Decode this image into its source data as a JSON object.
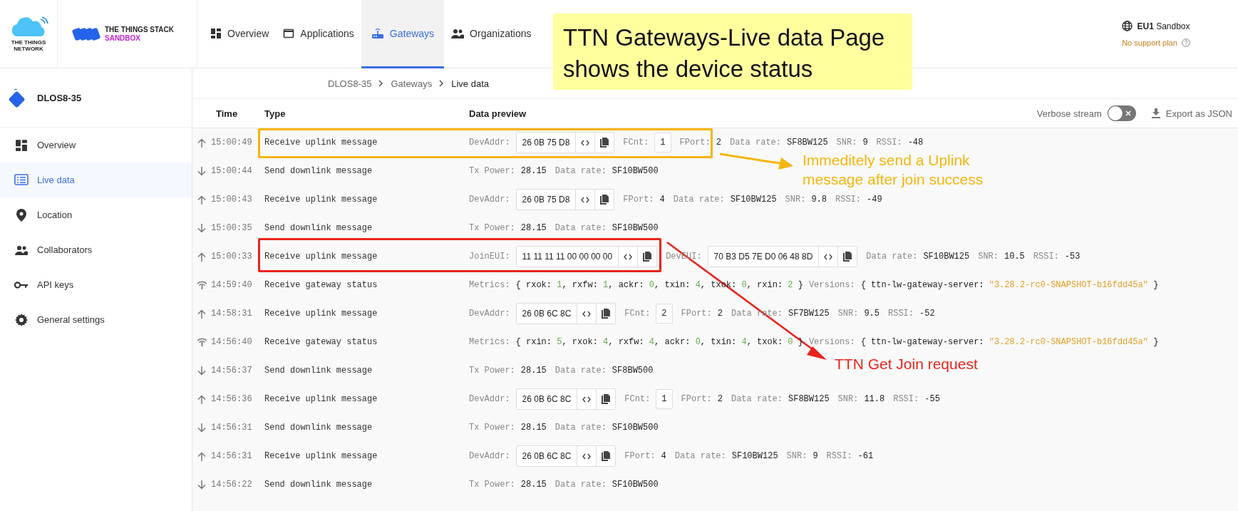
{
  "header": {
    "network_logo": [
      "THE THINGS",
      "NETWORK"
    ],
    "stack_logo": {
      "title": "THE THINGS STACK",
      "subtitle": "SANDBOX"
    },
    "nav": [
      {
        "label": "Overview",
        "selected": false
      },
      {
        "label": "Applications",
        "selected": false
      },
      {
        "label": "Gateways",
        "selected": true
      },
      {
        "label": "Organizations",
        "selected": false
      }
    ],
    "cluster": "**EU1** Sandbox",
    "support": "No support plan"
  },
  "sidebar": {
    "gateway": "DLOS8-35",
    "items": [
      {
        "label": "Overview",
        "selected": false
      },
      {
        "label": "Live data",
        "selected": true
      },
      {
        "label": "Location",
        "selected": false
      },
      {
        "label": "Collaborators",
        "selected": false
      },
      {
        "label": "API keys",
        "selected": false
      },
      {
        "label": "General settings",
        "selected": false
      }
    ]
  },
  "breadcrumb": [
    "DLOS8-35",
    "Gateways",
    "Live data"
  ],
  "table": {
    "columns": [
      "Time",
      "Type",
      "Data preview"
    ],
    "verbose_stream": {
      "label": "Verbose stream",
      "on": false
    },
    "export": "Export as JSON",
    "rows": [
      {
        "kind": "up",
        "time": "15:00:49",
        "type": "Receive uplink message",
        "preview": [
          {
            "kind": "key",
            "text": "DevAddr:"
          },
          {
            "kind": "hex",
            "text": "26 0B 75 D8"
          },
          {
            "kind": "key",
            "text": "FCnt:"
          },
          {
            "kind": "box",
            "text": "1"
          },
          {
            "kind": "key",
            "text": "FPort:"
          },
          {
            "kind": "val",
            "text": "2"
          },
          {
            "kind": "key",
            "text": "Data rate:"
          },
          {
            "kind": "val",
            "text": "SF8BW125"
          },
          {
            "kind": "key",
            "text": "SNR:"
          },
          {
            "kind": "val",
            "text": "9"
          },
          {
            "kind": "key",
            "text": "RSSI:"
          },
          {
            "kind": "val",
            "text": "-48"
          }
        ]
      },
      {
        "kind": "down",
        "time": "15:00:44",
        "type": "Send downlink message",
        "preview": [
          {
            "kind": "key",
            "text": "Tx Power:"
          },
          {
            "kind": "val",
            "text": "28.15"
          },
          {
            "kind": "key",
            "text": "Data rate:"
          },
          {
            "kind": "val",
            "text": "SF10BW500"
          }
        ]
      },
      {
        "kind": "up",
        "time": "15:00:43",
        "type": "Receive uplink message",
        "preview": [
          {
            "kind": "key",
            "text": "DevAddr:"
          },
          {
            "kind": "hex",
            "text": "26 0B 75 D8"
          },
          {
            "kind": "key",
            "text": "FPort:"
          },
          {
            "kind": "val",
            "text": "4"
          },
          {
            "kind": "key",
            "text": "Data rate:"
          },
          {
            "kind": "val",
            "text": "SF10BW125"
          },
          {
            "kind": "key",
            "text": "SNR:"
          },
          {
            "kind": "val",
            "text": "9.8"
          },
          {
            "kind": "key",
            "text": "RSSI:"
          },
          {
            "kind": "val",
            "text": "-49"
          }
        ]
      },
      {
        "kind": "down",
        "time": "15:00:35",
        "type": "Send downlink message",
        "preview": [
          {
            "kind": "key",
            "text": "Tx Power:"
          },
          {
            "kind": "val",
            "text": "28.15"
          },
          {
            "kind": "key",
            "text": "Data rate:"
          },
          {
            "kind": "val",
            "text": "SF10BW500"
          }
        ]
      },
      {
        "kind": "up",
        "time": "15:00:33",
        "type": "Receive uplink message",
        "preview": [
          {
            "kind": "key",
            "text": "JoinEUI:"
          },
          {
            "kind": "hex",
            "text": "11 11 11 11 00 00 00 00"
          },
          {
            "kind": "key",
            "text": "DevEUI:"
          },
          {
            "kind": "hex",
            "text": "70 B3 D5 7E D0 06 48 8D"
          },
          {
            "kind": "key",
            "text": "Data rate:"
          },
          {
            "kind": "val",
            "text": "SF10BW125"
          },
          {
            "kind": "key",
            "text": "SNR:"
          },
          {
            "kind": "val",
            "text": "10.5"
          },
          {
            "kind": "key",
            "text": "RSSI:"
          },
          {
            "kind": "val",
            "text": "-53"
          }
        ]
      },
      {
        "kind": "status",
        "time": "14:59:40",
        "type": "Receive gateway status",
        "preview": [
          {
            "kind": "key",
            "text": "Metrics:"
          },
          {
            "kind": "code",
            "text": "{ rxok: "
          },
          {
            "kind": "num",
            "text": "1"
          },
          {
            "kind": "code",
            "text": ", rxfw: "
          },
          {
            "kind": "num",
            "text": "1"
          },
          {
            "kind": "code",
            "text": ", ackr: "
          },
          {
            "kind": "num",
            "text": "0"
          },
          {
            "kind": "code",
            "text": ", txin: "
          },
          {
            "kind": "num",
            "text": "4"
          },
          {
            "kind": "code",
            "text": ", txok: "
          },
          {
            "kind": "num",
            "text": "0"
          },
          {
            "kind": "code",
            "text": ", rxin: "
          },
          {
            "kind": "num",
            "text": "2"
          },
          {
            "kind": "code",
            "text": " }"
          },
          {
            "kind": "key",
            "text": "Versions:"
          },
          {
            "kind": "code",
            "text": "{ ttn-lw-gateway-server: "
          },
          {
            "kind": "str",
            "text": "\"3.28.2-rc0-SNAPSHOT-b16fdd45a\""
          },
          {
            "kind": "code",
            "text": " }"
          }
        ]
      },
      {
        "kind": "up",
        "time": "14:58:31",
        "type": "Receive uplink message",
        "preview": [
          {
            "kind": "key",
            "text": "DevAddr:"
          },
          {
            "kind": "hex",
            "text": "26 0B 6C 8C"
          },
          {
            "kind": "key",
            "text": "FCnt:"
          },
          {
            "kind": "box",
            "text": "2"
          },
          {
            "kind": "key",
            "text": "FPort:"
          },
          {
            "kind": "val",
            "text": "2"
          },
          {
            "kind": "key",
            "text": "Data rate:"
          },
          {
            "kind": "val",
            "text": "SF7BW125"
          },
          {
            "kind": "key",
            "text": "SNR:"
          },
          {
            "kind": "val",
            "text": "9.5"
          },
          {
            "kind": "key",
            "text": "RSSI:"
          },
          {
            "kind": "val",
            "text": "-52"
          }
        ]
      },
      {
        "kind": "status",
        "time": "14:56:40",
        "type": "Receive gateway status",
        "preview": [
          {
            "kind": "key",
            "text": "Metrics:"
          },
          {
            "kind": "code",
            "text": "{ rxin: "
          },
          {
            "kind": "num",
            "text": "5"
          },
          {
            "kind": "code",
            "text": ", rxok: "
          },
          {
            "kind": "num",
            "text": "4"
          },
          {
            "kind": "code",
            "text": ", rxfw: "
          },
          {
            "kind": "num",
            "text": "4"
          },
          {
            "kind": "code",
            "text": ", ackr: "
          },
          {
            "kind": "num",
            "text": "0"
          },
          {
            "kind": "code",
            "text": ", txin: "
          },
          {
            "kind": "num",
            "text": "4"
          },
          {
            "kind": "code",
            "text": ", txok: "
          },
          {
            "kind": "num",
            "text": "0"
          },
          {
            "kind": "code",
            "text": " }"
          },
          {
            "kind": "key",
            "text": "Versions:"
          },
          {
            "kind": "code",
            "text": "{ ttn-lw-gateway-server: "
          },
          {
            "kind": "str",
            "text": "\"3.28.2-rc0-SNAPSHOT-b16fdd45a\""
          },
          {
            "kind": "code",
            "text": " }"
          }
        ]
      },
      {
        "kind": "down",
        "time": "14:56:37",
        "type": "Send downlink message",
        "preview": [
          {
            "kind": "key",
            "text": "Tx Power:"
          },
          {
            "kind": "val",
            "text": "28.15"
          },
          {
            "kind": "key",
            "text": "Data rate:"
          },
          {
            "kind": "val",
            "text": "SF8BW500"
          }
        ]
      },
      {
        "kind": "up",
        "time": "14:56:36",
        "type": "Receive uplink message",
        "preview": [
          {
            "kind": "key",
            "text": "DevAddr:"
          },
          {
            "kind": "hex",
            "text": "26 0B 6C 8C"
          },
          {
            "kind": "key",
            "text": "FCnt:"
          },
          {
            "kind": "box",
            "text": "1"
          },
          {
            "kind": "key",
            "text": "FPort:"
          },
          {
            "kind": "val",
            "text": "2"
          },
          {
            "kind": "key",
            "text": "Data rate:"
          },
          {
            "kind": "val",
            "text": "SF8BW125"
          },
          {
            "kind": "key",
            "text": "SNR:"
          },
          {
            "kind": "val",
            "text": "11.8"
          },
          {
            "kind": "key",
            "text": "RSSI:"
          },
          {
            "kind": "val",
            "text": "-55"
          }
        ]
      },
      {
        "kind": "down",
        "time": "14:56:31",
        "type": "Send downlink message",
        "preview": [
          {
            "kind": "key",
            "text": "Tx Power:"
          },
          {
            "kind": "val",
            "text": "28.15"
          },
          {
            "kind": "key",
            "text": "Data rate:"
          },
          {
            "kind": "val",
            "text": "SF10BW500"
          }
        ]
      },
      {
        "kind": "up",
        "time": "14:56:31",
        "type": "Receive uplink message",
        "preview": [
          {
            "kind": "key",
            "text": "DevAddr:"
          },
          {
            "kind": "hex",
            "text": "26 0B 6C 8C"
          },
          {
            "kind": "key",
            "text": "FPort:"
          },
          {
            "kind": "val",
            "text": "4"
          },
          {
            "kind": "key",
            "text": "Data rate:"
          },
          {
            "kind": "val",
            "text": "SF10BW125"
          },
          {
            "kind": "key",
            "text": "SNR:"
          },
          {
            "kind": "val",
            "text": "9"
          },
          {
            "kind": "key",
            "text": "RSSI:"
          },
          {
            "kind": "val",
            "text": "-61"
          }
        ]
      },
      {
        "kind": "down",
        "time": "14:56:22",
        "type": "Send downlink message",
        "preview": [
          {
            "kind": "key",
            "text": "Tx Power:"
          },
          {
            "kind": "val",
            "text": "28.15"
          },
          {
            "kind": "key",
            "text": "Data rate:"
          },
          {
            "kind": "val",
            "text": "SF10BW500"
          }
        ]
      }
    ]
  },
  "annotations": {
    "title": [
      "TTN Gateways-Live data Page",
      "shows the device status"
    ],
    "notes": [
      {
        "text": [
          "Immeditely send a Uplink",
          "message after join success"
        ],
        "color": "#f5b50a"
      },
      {
        "text": [
          "TTN Get Join request"
        ],
        "color": "#e8231b"
      }
    ]
  }
}
